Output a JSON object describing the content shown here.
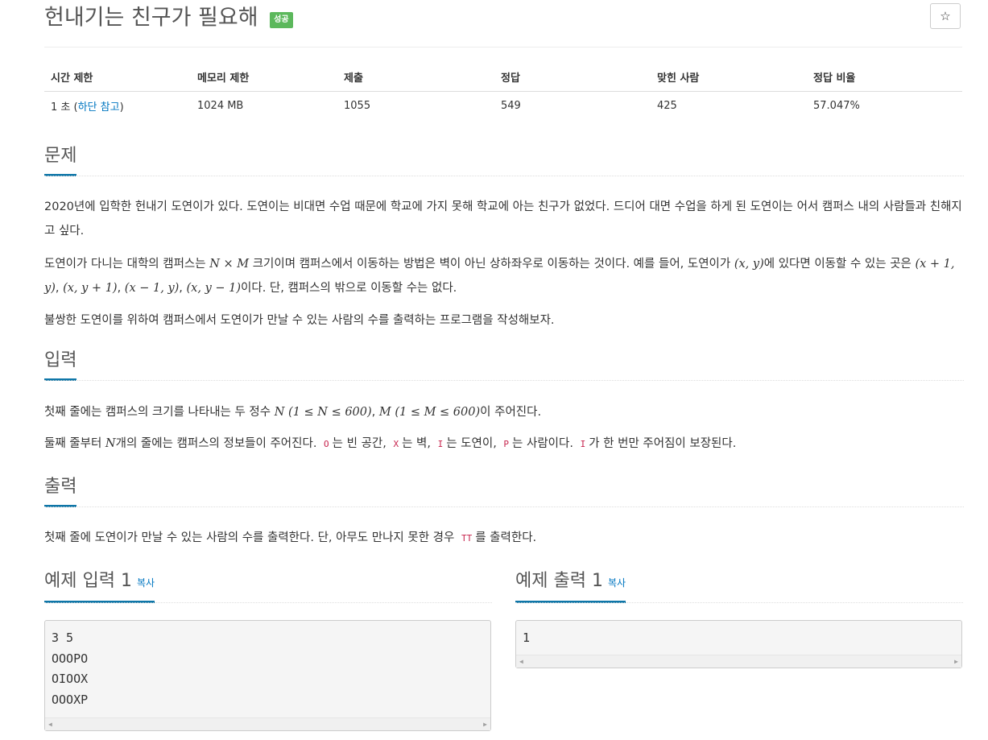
{
  "header": {
    "title": "헌내기는 친구가 필요해",
    "status_badge": "성공",
    "star_icon": "☆"
  },
  "info_table": {
    "headers": [
      "시간 제한",
      "메모리 제한",
      "제출",
      "정답",
      "맞힌 사람",
      "정답 비율"
    ],
    "time_limit_value": "1 초 (",
    "time_limit_link": "하단 참고",
    "time_limit_close": ")",
    "memory_limit": "1024 MB",
    "submissions": "1055",
    "accepted": "549",
    "solvers": "425",
    "ratio": "57.047%"
  },
  "sections": {
    "problem_title": "문제",
    "input_title": "입력",
    "output_title": "출력"
  },
  "problem": {
    "p1": "2020년에 입학한 헌내기 도연이가 있다. 도연이는 비대면 수업 때문에 학교에 가지 못해 학교에 아는 친구가 없었다. 드디어 대면 수업을 하게 된 도연이는 어서 캠퍼스 내의 사람들과 친해지고 싶다.",
    "p2_a": "도연이가 다니는 대학의 캠퍼스는 ",
    "p2_math1": "N × M",
    "p2_b": " 크기이며 캠퍼스에서 이동하는 방법은 벽이 아닌 상하좌우로 이동하는 것이다. 예를 들어, 도연이가 ",
    "p2_math2": "(x, y)",
    "p2_c": "에 있다면 이동할 수 있는 곳은 ",
    "p2_math3": "(x + 1, y)",
    "p2_sep1": ", ",
    "p2_math4": "(x, y + 1)",
    "p2_sep2": ", ",
    "p2_math5": "(x − 1, y)",
    "p2_sep3": ", ",
    "p2_math6": "(x, y − 1)",
    "p2_d": "이다. 단, 캠퍼스의 밖으로 이동할 수는 없다.",
    "p3": "불쌍한 도연이를 위하여 캠퍼스에서 도연이가 만날 수 있는 사람의 수를 출력하는 프로그램을 작성해보자."
  },
  "input": {
    "p1_a": "첫째 줄에는 캠퍼스의 크기를 나타내는 두 정수 ",
    "p1_math1": "N (1 ≤ N ≤ 600)",
    "p1_sep": ", ",
    "p1_math2": "M (1 ≤ M ≤ 600)",
    "p1_b": "이 주어진다.",
    "p2_a": "둘째 줄부터 ",
    "p2_math": "N",
    "p2_b": "개의 줄에는 캠퍼스의 정보들이 주어진다. ",
    "code_o": "O",
    "t_o": "는 빈 공간, ",
    "code_x": "X",
    "t_x": "는 벽, ",
    "code_i": "I",
    "t_i": "는 도연이, ",
    "code_p": "P",
    "t_p": "는 사람이다. ",
    "code_i2": "I",
    "t_end": "가 한 번만 주어짐이 보장된다."
  },
  "output": {
    "p1_a": "첫째 줄에 도연이가 만날 수 있는 사람의 수를 출력한다. 단, 아무도 만나지 못한 경우 ",
    "code_tt": "TT",
    "p1_b": "를 출력한다."
  },
  "examples": {
    "input_title": "예제 입력 1",
    "output_title": "예제 출력 1",
    "copy_label": "복사",
    "input_text": "3 5\nOOOPO\nOIOOX\nOOOXP",
    "output_text": "1"
  },
  "colors": {
    "accent_blue": "#0e76a8",
    "link_blue": "#0076c0",
    "badge_green": "#5cb85c",
    "code_red": "#c7254e"
  }
}
